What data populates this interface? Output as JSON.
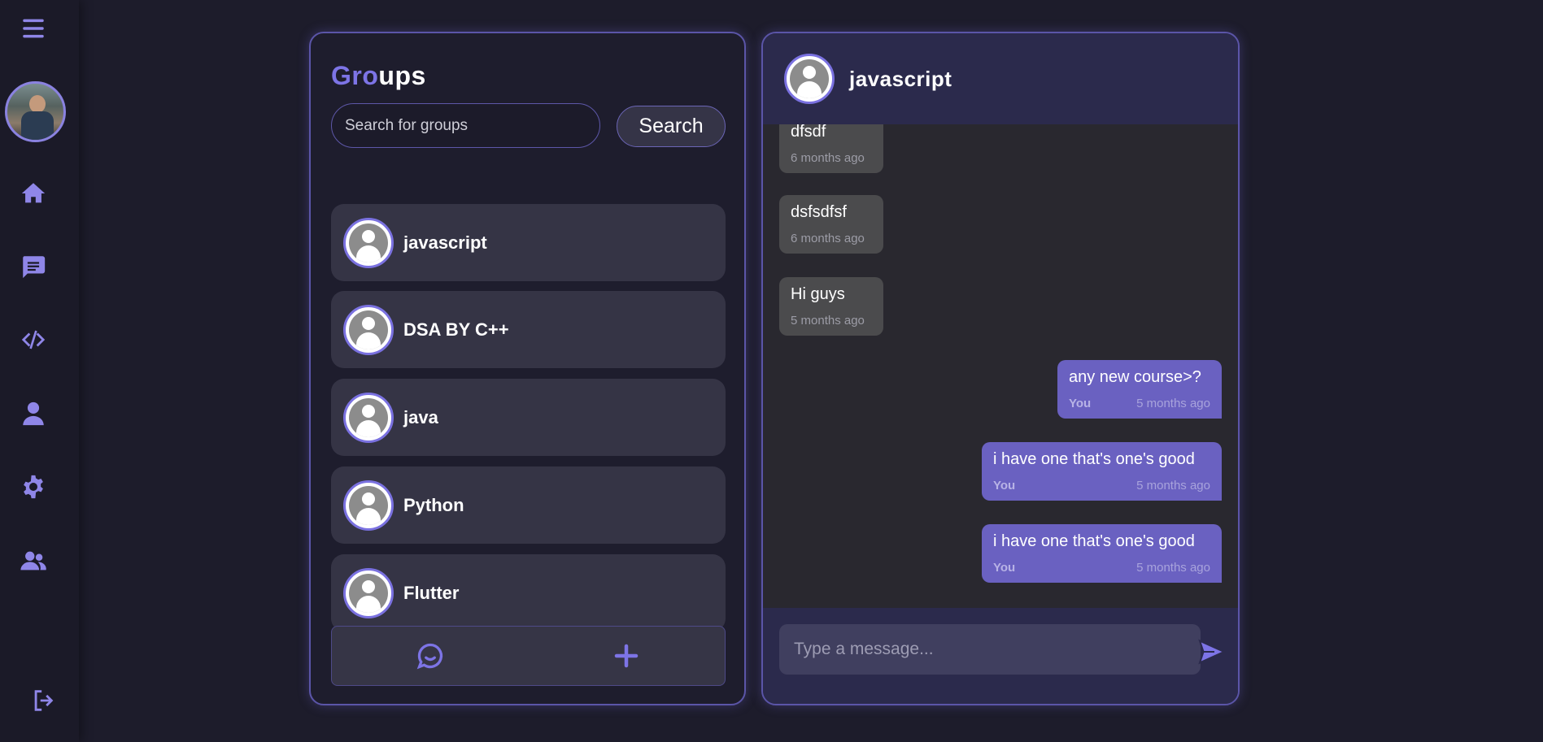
{
  "sidebar": {
    "menu_icon": "hamburger-icon",
    "nav": [
      "home-icon",
      "chat-icon",
      "code-icon",
      "user-icon",
      "gear-icon",
      "users-icon"
    ],
    "logout_icon": "logout-icon",
    "accent": "#8f86e8"
  },
  "groups": {
    "title_part1": "Gro",
    "title_part2": "ups",
    "search_placeholder": "Search for groups",
    "search_button": "Search",
    "items": [
      {
        "name": "javascript"
      },
      {
        "name": "DSA BY C++"
      },
      {
        "name": "java"
      },
      {
        "name": "Python"
      },
      {
        "name": "Flutter"
      }
    ],
    "bottom_icons": [
      "chat-bubble-icon",
      "plus-icon"
    ]
  },
  "chat": {
    "title": "javascript",
    "messages": [
      {
        "text": "dfsdf",
        "time": "6 months ago",
        "mine": false
      },
      {
        "text": "dsfsdfsf",
        "time": "6 months ago",
        "mine": false
      },
      {
        "text": "Hi guys",
        "time": "5 months ago",
        "mine": false
      },
      {
        "text": "any new course>?",
        "sender": "You",
        "time": "5 months ago",
        "mine": true
      },
      {
        "text": "i have one that's one's good",
        "sender": "You",
        "time": "5 months ago",
        "mine": true
      },
      {
        "text": "i have one that's one's good",
        "sender": "You",
        "time": "5 months ago",
        "mine": true
      }
    ],
    "input_placeholder": "Type a message...",
    "send_icon": "send-icon"
  },
  "colors": {
    "background": "#1d1c2b",
    "accent": "#7d74e6",
    "outgoing_bubble": "#6a61c1",
    "incoming_bubble": "#4b4b4d"
  }
}
